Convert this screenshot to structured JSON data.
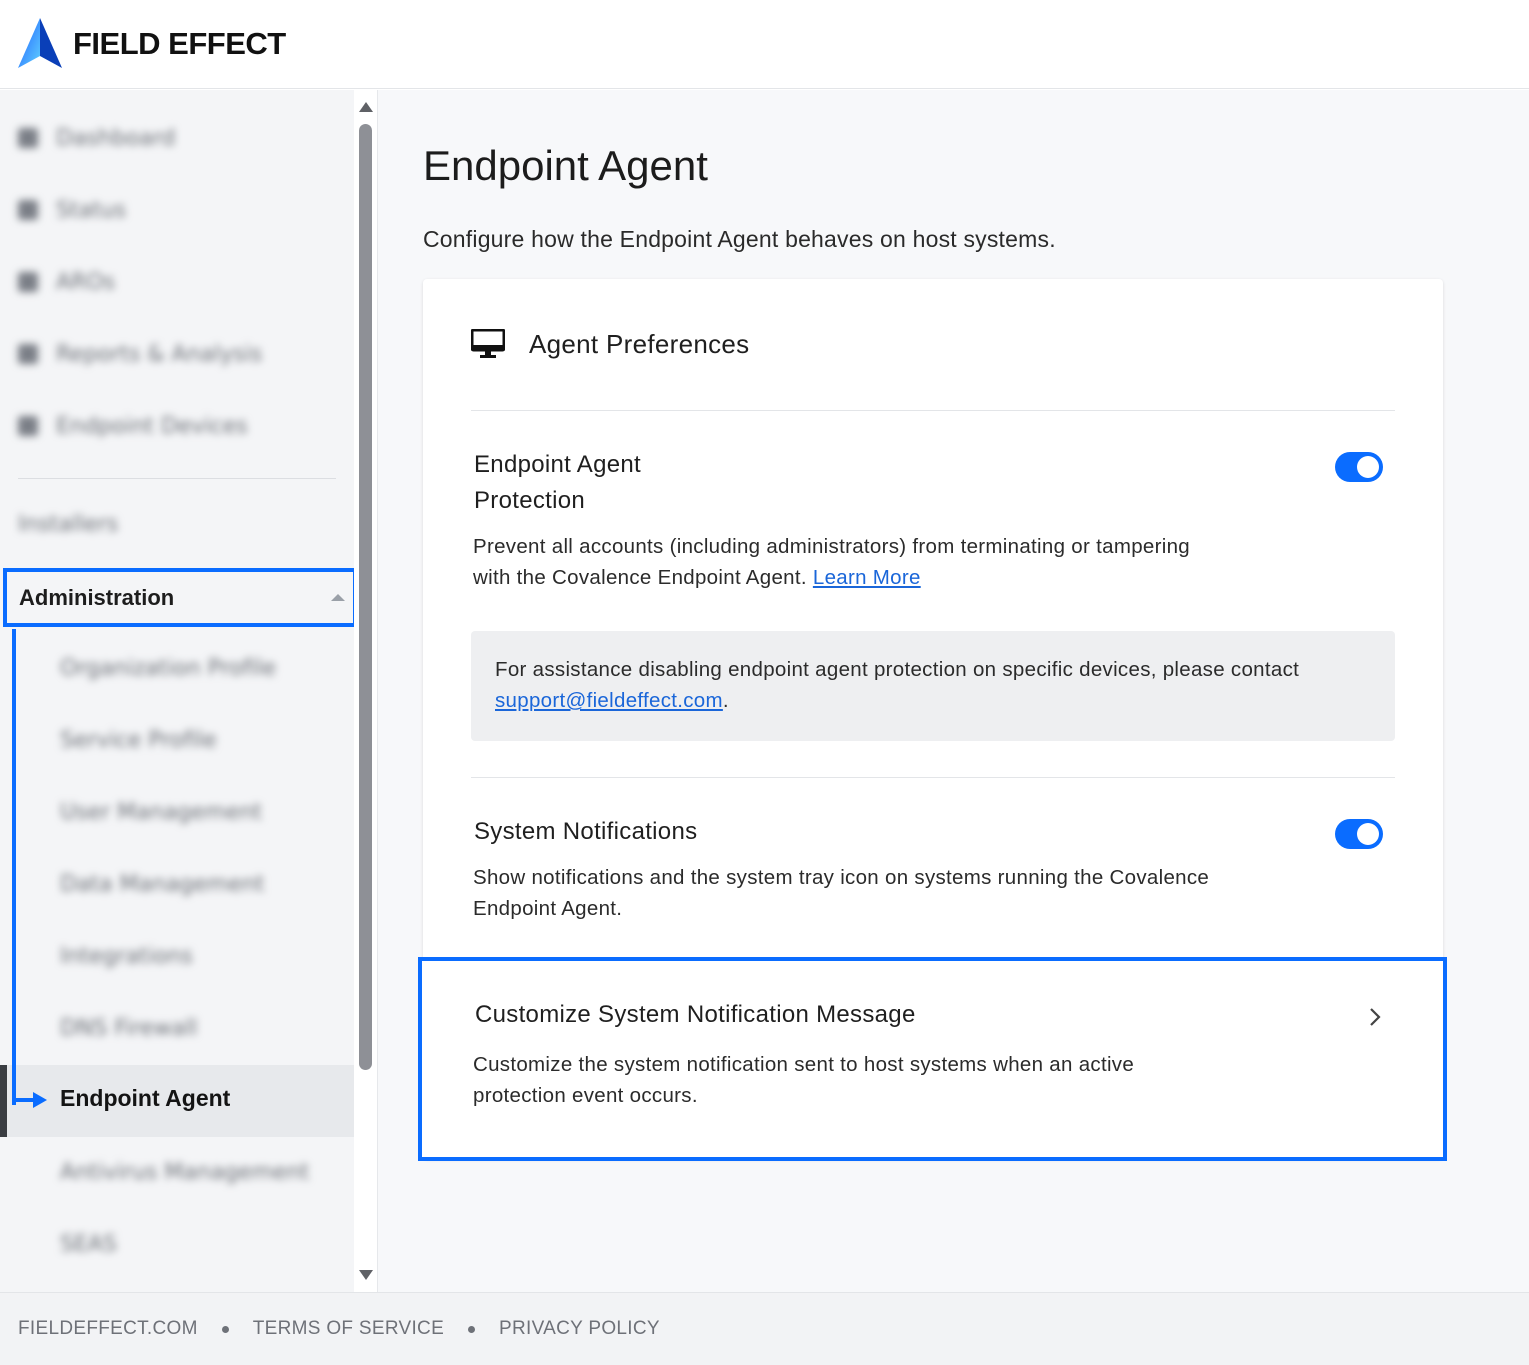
{
  "header": {
    "brand": "FIELD EFFECT"
  },
  "sidebar": {
    "top_items": [
      {
        "label": "Dashboard",
        "icon": "dashboard-icon"
      },
      {
        "label": "Status",
        "icon": "status-icon"
      },
      {
        "label": "AROs",
        "icon": "warning-icon"
      },
      {
        "label": "Reports & Analysis",
        "icon": "reports-icon"
      },
      {
        "label": "Endpoint Devices",
        "icon": "devices-icon"
      }
    ],
    "installers": "Installers",
    "administration": {
      "label": "Administration",
      "expanded": true,
      "children": [
        {
          "label": "Organization Profile"
        },
        {
          "label": "Service Profile"
        },
        {
          "label": "User Management"
        },
        {
          "label": "Data Management"
        },
        {
          "label": "Integrations"
        },
        {
          "label": "DNS Firewall"
        },
        {
          "label": "Endpoint Agent",
          "active": true
        },
        {
          "label": "Antivirus Management"
        },
        {
          "label": "SEAS"
        }
      ]
    }
  },
  "main": {
    "title": "Endpoint Agent",
    "subtitle": "Configure how the Endpoint Agent behaves on host systems.",
    "card": {
      "title": "Agent Preferences",
      "icon": "monitor-icon",
      "settings": [
        {
          "title_line1": "Endpoint Agent",
          "title_line2": "Protection",
          "description": "Prevent all accounts (including administrators) from terminating or tampering with the Covalence Endpoint Agent.",
          "link": "Learn More",
          "enabled": true,
          "info": {
            "text": "For assistance disabling endpoint agent protection on specific devices, please contact",
            "email": "support@fieldeffect.com",
            "suffix": "."
          }
        },
        {
          "title": "System Notifications",
          "description": "Show notifications and the system tray icon on systems running the Covalence Endpoint Agent.",
          "enabled": true
        },
        {
          "title": "Customize System Notification Message",
          "description": "Customize the system notification sent to host systems when an active protection event occurs."
        }
      ]
    }
  },
  "footer": {
    "links": [
      "FIELDEFFECT.COM",
      "TERMS OF SERVICE",
      "PRIVACY POLICY"
    ]
  },
  "colors": {
    "accent": "#0a6cff",
    "link": "#1a66d9",
    "sidebar_bg": "#f4f5f7",
    "main_bg": "#f7f8fa"
  }
}
